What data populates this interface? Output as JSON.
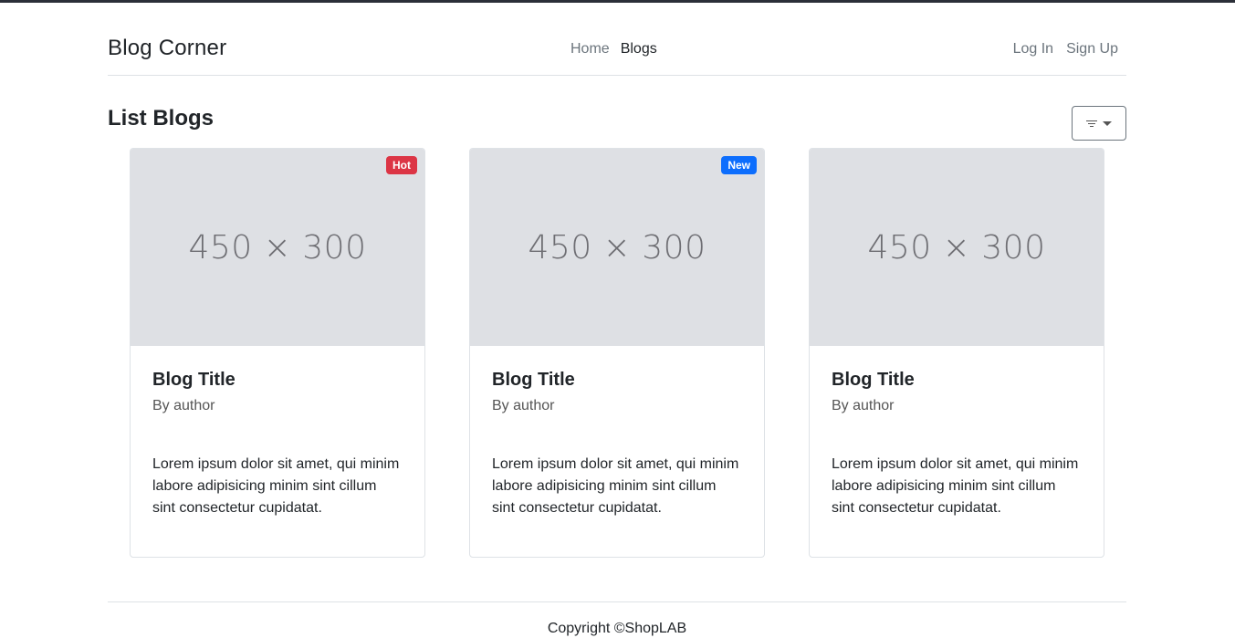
{
  "navbar": {
    "brand": "Blog Corner",
    "links": [
      {
        "label": "Home"
      },
      {
        "label": "Blogs"
      }
    ],
    "auth": {
      "login": "Log In",
      "signup": "Sign Up"
    }
  },
  "main": {
    "title": "List Blogs",
    "filter_icon": "filter-icon"
  },
  "cards": [
    {
      "image_text": "450 × 300",
      "badge": "Hot",
      "badge_color": "#dc3545",
      "title": "Blog Title",
      "author": "By author",
      "text": "Lorem ipsum dolor sit amet, qui minim labore adipisicing minim sint cillum sint consectetur cupidatat."
    },
    {
      "image_text": "450 × 300",
      "badge": "New",
      "badge_color": "#0d6efd",
      "title": "Blog Title",
      "author": "By author",
      "text": "Lorem ipsum dolor sit amet, qui minim labore adipisicing minim sint cillum sint consectetur cupidatat."
    },
    {
      "image_text": "450 × 300",
      "badge": "",
      "badge_color": "",
      "title": "Blog Title",
      "author": "By author",
      "text": "Lorem ipsum dolor sit amet, qui minim labore adipisicing minim sint cillum sint consectetur cupidatat."
    }
  ],
  "footer": {
    "text": "Copyright ©ShopLAB"
  }
}
